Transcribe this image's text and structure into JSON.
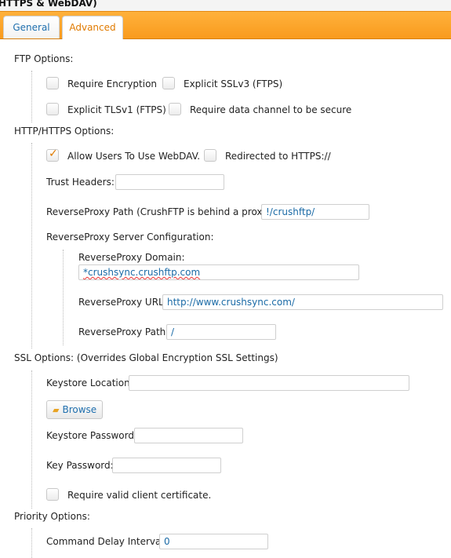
{
  "window": {
    "title_fragment": "HTTPS & WebDAV)"
  },
  "tabs": [
    {
      "label": "General",
      "active": false
    },
    {
      "label": "Advanced",
      "active": true
    }
  ],
  "ftp": {
    "heading": "FTP Options:",
    "require_encryption": {
      "label": "Require Encryption",
      "checked": false
    },
    "explicit_sslv3": {
      "label": "Explicit SSLv3 (FTPS)",
      "checked": false
    },
    "explicit_tlsv1": {
      "label": "Explicit TLSv1 (FTPS)",
      "checked": false
    },
    "secure_data_channel": {
      "label": "Require data channel to be secure",
      "checked": false
    }
  },
  "http": {
    "heading": "HTTP/HTTPS Options:",
    "allow_webdav": {
      "label": "Allow Users To Use WebDAV.",
      "checked": true
    },
    "redirect_https": {
      "label": "Redirected to HTTPS://",
      "checked": false
    },
    "trust_headers": {
      "label": "Trust Headers:",
      "value": ""
    },
    "reverse_proxy_path": {
      "label": "ReverseProxy Path (CrushFTP is behind a proxy):",
      "value": "!/crushftp/"
    },
    "server_config": {
      "heading": "ReverseProxy Server Configuration:",
      "domain": {
        "label": "ReverseProxy Domain:",
        "value": "*crushsync.crushftp.com"
      },
      "url": {
        "label": "ReverseProxy URL:",
        "value": "http://www.crushsync.com/"
      },
      "path": {
        "label": "ReverseProxy Path:",
        "value": "/"
      }
    }
  },
  "ssl": {
    "heading": "SSL Options: (Overrides Global Encryption SSL Settings)",
    "keystore_location": {
      "label": "Keystore Location:",
      "value": ""
    },
    "browse_label": "Browse",
    "keystore_password": {
      "label": "Keystore Password:",
      "value": ""
    },
    "key_password": {
      "label": "Key Password:",
      "value": ""
    },
    "require_client_cert": {
      "label": "Require valid client certificate.",
      "checked": false
    }
  },
  "priority": {
    "heading": "Priority Options:",
    "command_delay": {
      "label": "Command Delay Interval:",
      "value": "0"
    }
  },
  "colors": {
    "accent": "#f99b1d",
    "link": "#1f6fae",
    "check": "#e07a00"
  }
}
